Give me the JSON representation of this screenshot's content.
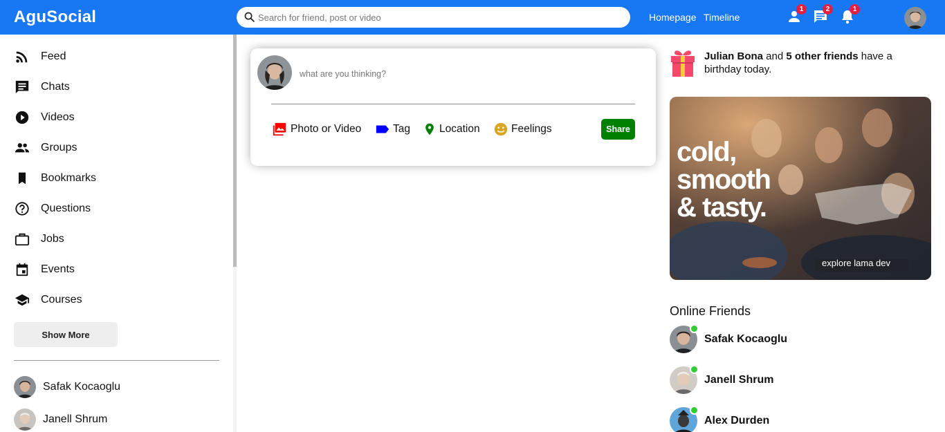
{
  "topbar": {
    "logo": "AguSocial",
    "search_placeholder": "Search for friend, post or video",
    "links": [
      "Homepage",
      "Timeline"
    ],
    "badges": {
      "friends": "1",
      "messages": "2",
      "notifications": "1"
    },
    "colors": {
      "bar": "#1877f2",
      "badge": "#e41e3f"
    }
  },
  "sidebar": {
    "items": [
      {
        "label": "Feed",
        "icon": "rss-feed-icon"
      },
      {
        "label": "Chats",
        "icon": "chat-icon"
      },
      {
        "label": "Videos",
        "icon": "play-circle-icon"
      },
      {
        "label": "Groups",
        "icon": "group-icon"
      },
      {
        "label": "Bookmarks",
        "icon": "bookmark-icon"
      },
      {
        "label": "Questions",
        "icon": "help-circle-icon"
      },
      {
        "label": "Jobs",
        "icon": "briefcase-icon"
      },
      {
        "label": "Events",
        "icon": "calendar-icon"
      },
      {
        "label": "Courses",
        "icon": "school-icon"
      }
    ],
    "show_more": "Show More",
    "friends": [
      "Safak Kocaoglu",
      "Janell Shrum"
    ]
  },
  "share": {
    "placeholder": "what are you thinking?",
    "options": {
      "media": "Photo or Video",
      "tag": "Tag",
      "location": "Location",
      "feelings": "Feelings"
    },
    "button": "Share",
    "colors": {
      "media": "#ff0000",
      "tag": "#0000ff",
      "location": "#008000",
      "feelings": "#daa520",
      "button": "#008000"
    }
  },
  "rightbar": {
    "birthday": {
      "name": "Julian Bona",
      "mid": " and ",
      "others": "5 other friends",
      "tail": " have a birthday today."
    },
    "ad": {
      "line1": "cold,",
      "line2": "smooth",
      "line3": "& tasty.",
      "footer": "explore lama dev"
    },
    "online_title": "Online Friends",
    "online_friends": [
      "Safak Kocaoglu",
      "Janell Shrum",
      "Alex Durden"
    ],
    "online_color": "#32cd32"
  }
}
